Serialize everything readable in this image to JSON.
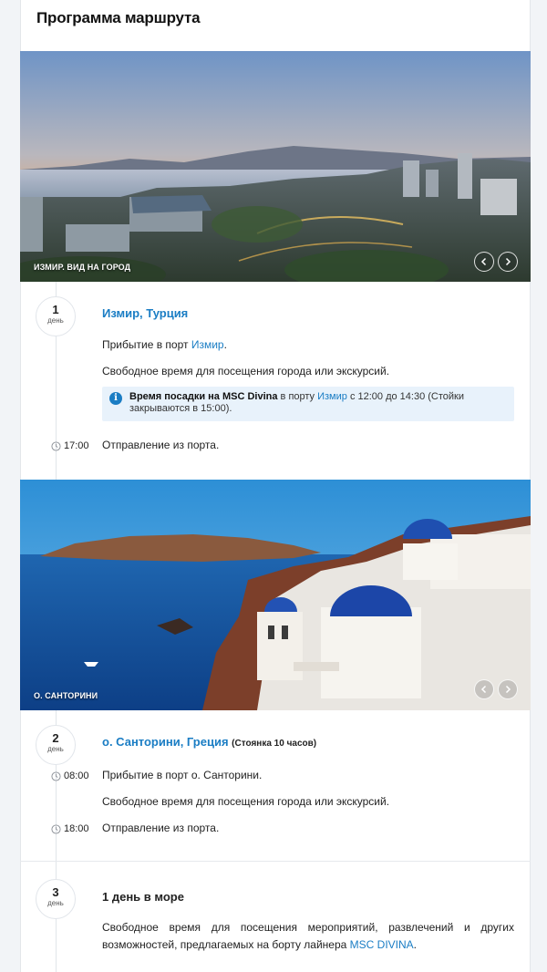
{
  "section": {
    "title": "Программа маршрута"
  },
  "photos": [
    {
      "caption": "ИЗМИР. ВИД НА ГОРОД"
    },
    {
      "caption": "О. САНТОРИНИ"
    }
  ],
  "days": [
    {
      "number": "1",
      "word": "день",
      "title": "Измир, Турция",
      "arrival_prefix": "Прибытие в порт ",
      "arrival_port": "Измир",
      "arrival_suffix": ".",
      "free_time": "Свободное время для посещения города или экскурсий.",
      "boarding": {
        "strong": "Время посадки на MSC Divina",
        "mid": " в порту ",
        "port": "Измир",
        "rest1": " с 12:00 до 14:30 (Стойки",
        "rest2": "закрываются в 15:00)."
      },
      "departure_time": "17:00",
      "departure_text": "Отправление из порта."
    },
    {
      "number": "2",
      "word": "день",
      "title": "о. Санторини, Греция",
      "stay": "(Стоянка 10 часов)",
      "arrival_time": "08:00",
      "arrival_text": "Прибытие в порт о. Санторини.",
      "free_time": "Свободное время для посещения города или экскурсий.",
      "departure_time": "18:00",
      "departure_text": "Отправление из порта."
    },
    {
      "number": "3",
      "word": "день",
      "title": "1 день в море",
      "text_prefix": "Свободное время для посещения мероприятий, развлечений и других возможностей, предлагаемых на борту лайнера ",
      "ship_link": "MSC DIVINA",
      "text_suffix": "."
    }
  ],
  "colors": {
    "link": "#1a7dc4",
    "info_bg": "#e8f2fb"
  },
  "icons": {
    "prev": "chevron-left-icon",
    "next": "chevron-right-icon",
    "time": "clock-icon",
    "info": "info-icon"
  }
}
